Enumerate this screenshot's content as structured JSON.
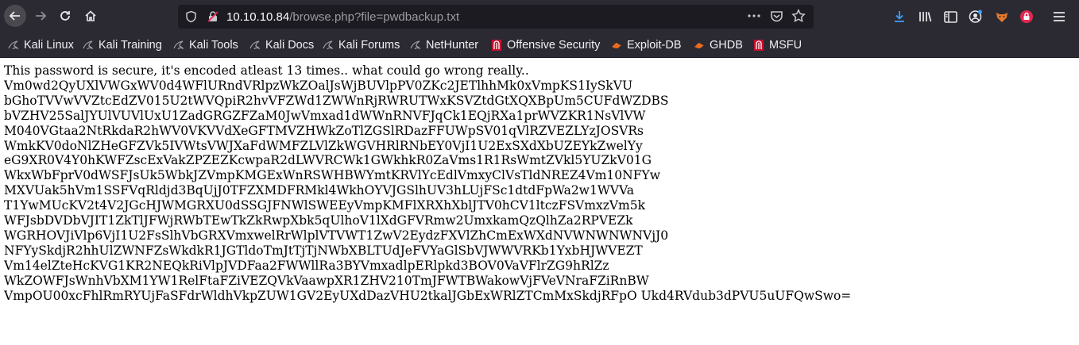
{
  "browser": {
    "url_host": "10.10.10.84",
    "url_path": "/browse.php?file=pwdbackup.txt",
    "icons": [
      "back-icon",
      "forward-icon",
      "reload-icon",
      "home-icon",
      "shield-icon",
      "insecure-lock-icon",
      "more-icon",
      "pocket-icon",
      "star-icon",
      "download-icon",
      "library-icon",
      "sidebar-icon",
      "account-icon",
      "fox-extension-icon",
      "extension-icon",
      "menu-icon"
    ]
  },
  "bookmarks": [
    {
      "label": "Kali Linux",
      "icon": "kali-dragon-icon"
    },
    {
      "label": "Kali Training",
      "icon": "kali-dragon-icon"
    },
    {
      "label": "Kali Tools",
      "icon": "kali-dragon-icon"
    },
    {
      "label": "Kali Docs",
      "icon": "kali-dragon-icon"
    },
    {
      "label": "Kali Forums",
      "icon": "kali-dragon-icon"
    },
    {
      "label": "NetHunter",
      "icon": "kali-dragon-icon"
    },
    {
      "label": "Offensive Security",
      "icon": "offsec-icon"
    },
    {
      "label": "Exploit-DB",
      "icon": "exploitdb-icon"
    },
    {
      "label": "GHDB",
      "icon": "exploitdb-icon"
    },
    {
      "label": "MSFU",
      "icon": "offsec-icon"
    }
  ],
  "page": {
    "lines": [
      "This password is secure, it's encoded atleast 13 times.. what could go wrong really..",
      "Vm0wd2QyUXlVWGxWV0d4WFlURndVRlpzWkZOalJsWjBUVlpPV0ZKc2JETlhhMk0xVmpKS1IySkVU",
      "bGhoTVVwVVZtcEdZV015U2tWVQpiR2hvVFZWd1ZWWnRjRWRUTWxKSVZtdGtXQXBpUm5CUFdWZDBS",
      "bVZHV25SalJYUlVUVlUxU1ZadGRGZFZaM0JwVmxad1dWWnRNVFJqCk1EQjRXa1prWVZKR1NsVlVW",
      "M040VGtaa2NtRkdaR2hWV0VKVVdXeGFTMVZHWkZoTlZGSlRDazFFUWpSV01qVlRZVEZLYzJOSVRs",
      "WmkKV0doNlZHeGFZVk5IVWtsVWJXaFdWMFZLVlZkWGVHRlRNbEY0VjI1U2ExSXdXbUZEYkZwelYy",
      "eG9XR0V4Y0hKWFZscExVakZPZEZKcwpaR2dLWVRCWk1GWkhkR0ZaVms1R1RsWmtZVkl5YUZkV01G",
      "WkxWbFprV0dWSFJsUk5WbkJZVmpKMGExWnRSWHBWYmtKRVlYcEdlVmxyClVsTldNREZ4Vm10NFYw",
      "MXVUak5hVm1SSFVqRldjd3BqUjJ0TFZXMDFRMkl4WkhOYVJGSlhUV3hLUjFSc1dtdFpWa2w1WVVa",
      "T1YwMUcKV2t4V2JGcHJWMGRXU0dSSGJFNWlSWEEyVmpKMFlXRXhXblJTV0hCV1ltczFSVmxzVm5k",
      "WFJsbDVDbVJIT1ZkTlJFWjRWbTEwTkZkRwpXbk5qUlhoV1lXdGFVRmw2UmxkamQzQlhZa2RPVEZk",
      "WGRHOVJiVlp6VjI1U2FsSlhVbGRXVmxwelRrWlplVTVWT1ZwV2EydzFXVlZhCmExWXdNVWNWNWNVjJ0",
      "NFYySkdjR2hhUlZWNFZsWkdkR1JGTldoTmJtTjTjNWbXBLTUdJeFVYaGlSbVJWWVRKb1YxbHJWVEZT",
      "Vm14elZteHcKVG1KR2NEQkRiVlpJVDFaa2FWWllRa3BYVmxadlpERlpkd3BOV0VaVFlrZG9hRlZz",
      "WkZOWFJsWnhVbXM1YW1RelFtaFZiVEZQVkVaawpXR1ZHV210TmJFWTBWakowVjFVeVNraFZiRnBW",
      "VmpOU00xcFhlRmRYUjFaSFdrWldhVkpZUW1GV2EyUXdDazVHU2tkalJGbExWRlZTCmMxSkdjRFpO Ukd4RVdub3dPVU5uUFQwSwo="
    ]
  }
}
